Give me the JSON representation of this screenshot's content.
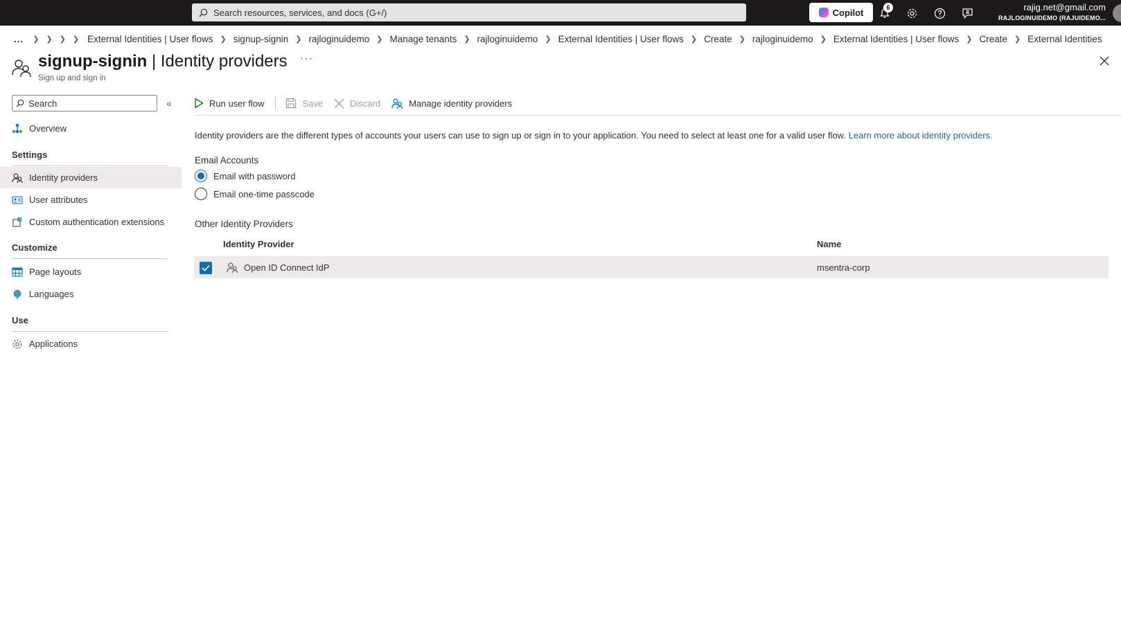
{
  "topbar": {
    "search_placeholder": "Search resources, services, and docs (G+/)",
    "copilot_label": "Copilot",
    "notification_count": "6",
    "account_email": "rajig.net@gmail.com",
    "account_tenant": "RAJLOGINUIDEMO (RAJUIDEMO..."
  },
  "breadcrumb": {
    "overflow": "...",
    "items": [
      "External Identities | User flows",
      "signup-signin",
      "rajloginuidemo",
      "Manage tenants",
      "rajloginuidemo",
      "External Identities | User flows",
      "Create",
      "rajloginuidemo",
      "External Identities | User flows",
      "Create",
      "External Identities"
    ]
  },
  "header": {
    "title_bold": "signup-signin",
    "title_rest": " | Identity providers",
    "more": "···",
    "subtitle": "Sign up and sign in"
  },
  "sidebar": {
    "search_placeholder": "Search",
    "collapse": "«",
    "overview": "Overview",
    "sections": [
      {
        "heading": "Settings",
        "items": [
          "Identity providers",
          "User attributes",
          "Custom authentication extensions"
        ]
      },
      {
        "heading": "Customize",
        "items": [
          "Page layouts",
          "Languages"
        ]
      },
      {
        "heading": "Use",
        "items": [
          "Applications"
        ]
      }
    ]
  },
  "toolbar": {
    "run_user_flow": "Run user flow",
    "save": "Save",
    "discard": "Discard",
    "manage_identity_providers": "Manage identity providers"
  },
  "main": {
    "description": "Identity providers are the different types of accounts your users can use to sign up or sign in to your application. You need to select at least one for a valid user flow.",
    "learn_more": "Learn more about identity providers.",
    "email_accounts_label": "Email Accounts",
    "email_options": [
      {
        "label": "Email with password",
        "selected": true
      },
      {
        "label": "Email one-time passcode",
        "selected": false
      }
    ],
    "other_providers_label": "Other Identity Providers",
    "table": {
      "columns": [
        "Identity Provider",
        "Name"
      ],
      "rows": [
        {
          "provider": "Open ID Connect IdP",
          "name": "msentra-corp",
          "checked": true
        }
      ]
    }
  },
  "colors": {
    "accent": "#0f6cbd",
    "topbar_bg": "#1b1a19",
    "selected_bg": "#edebe9"
  }
}
